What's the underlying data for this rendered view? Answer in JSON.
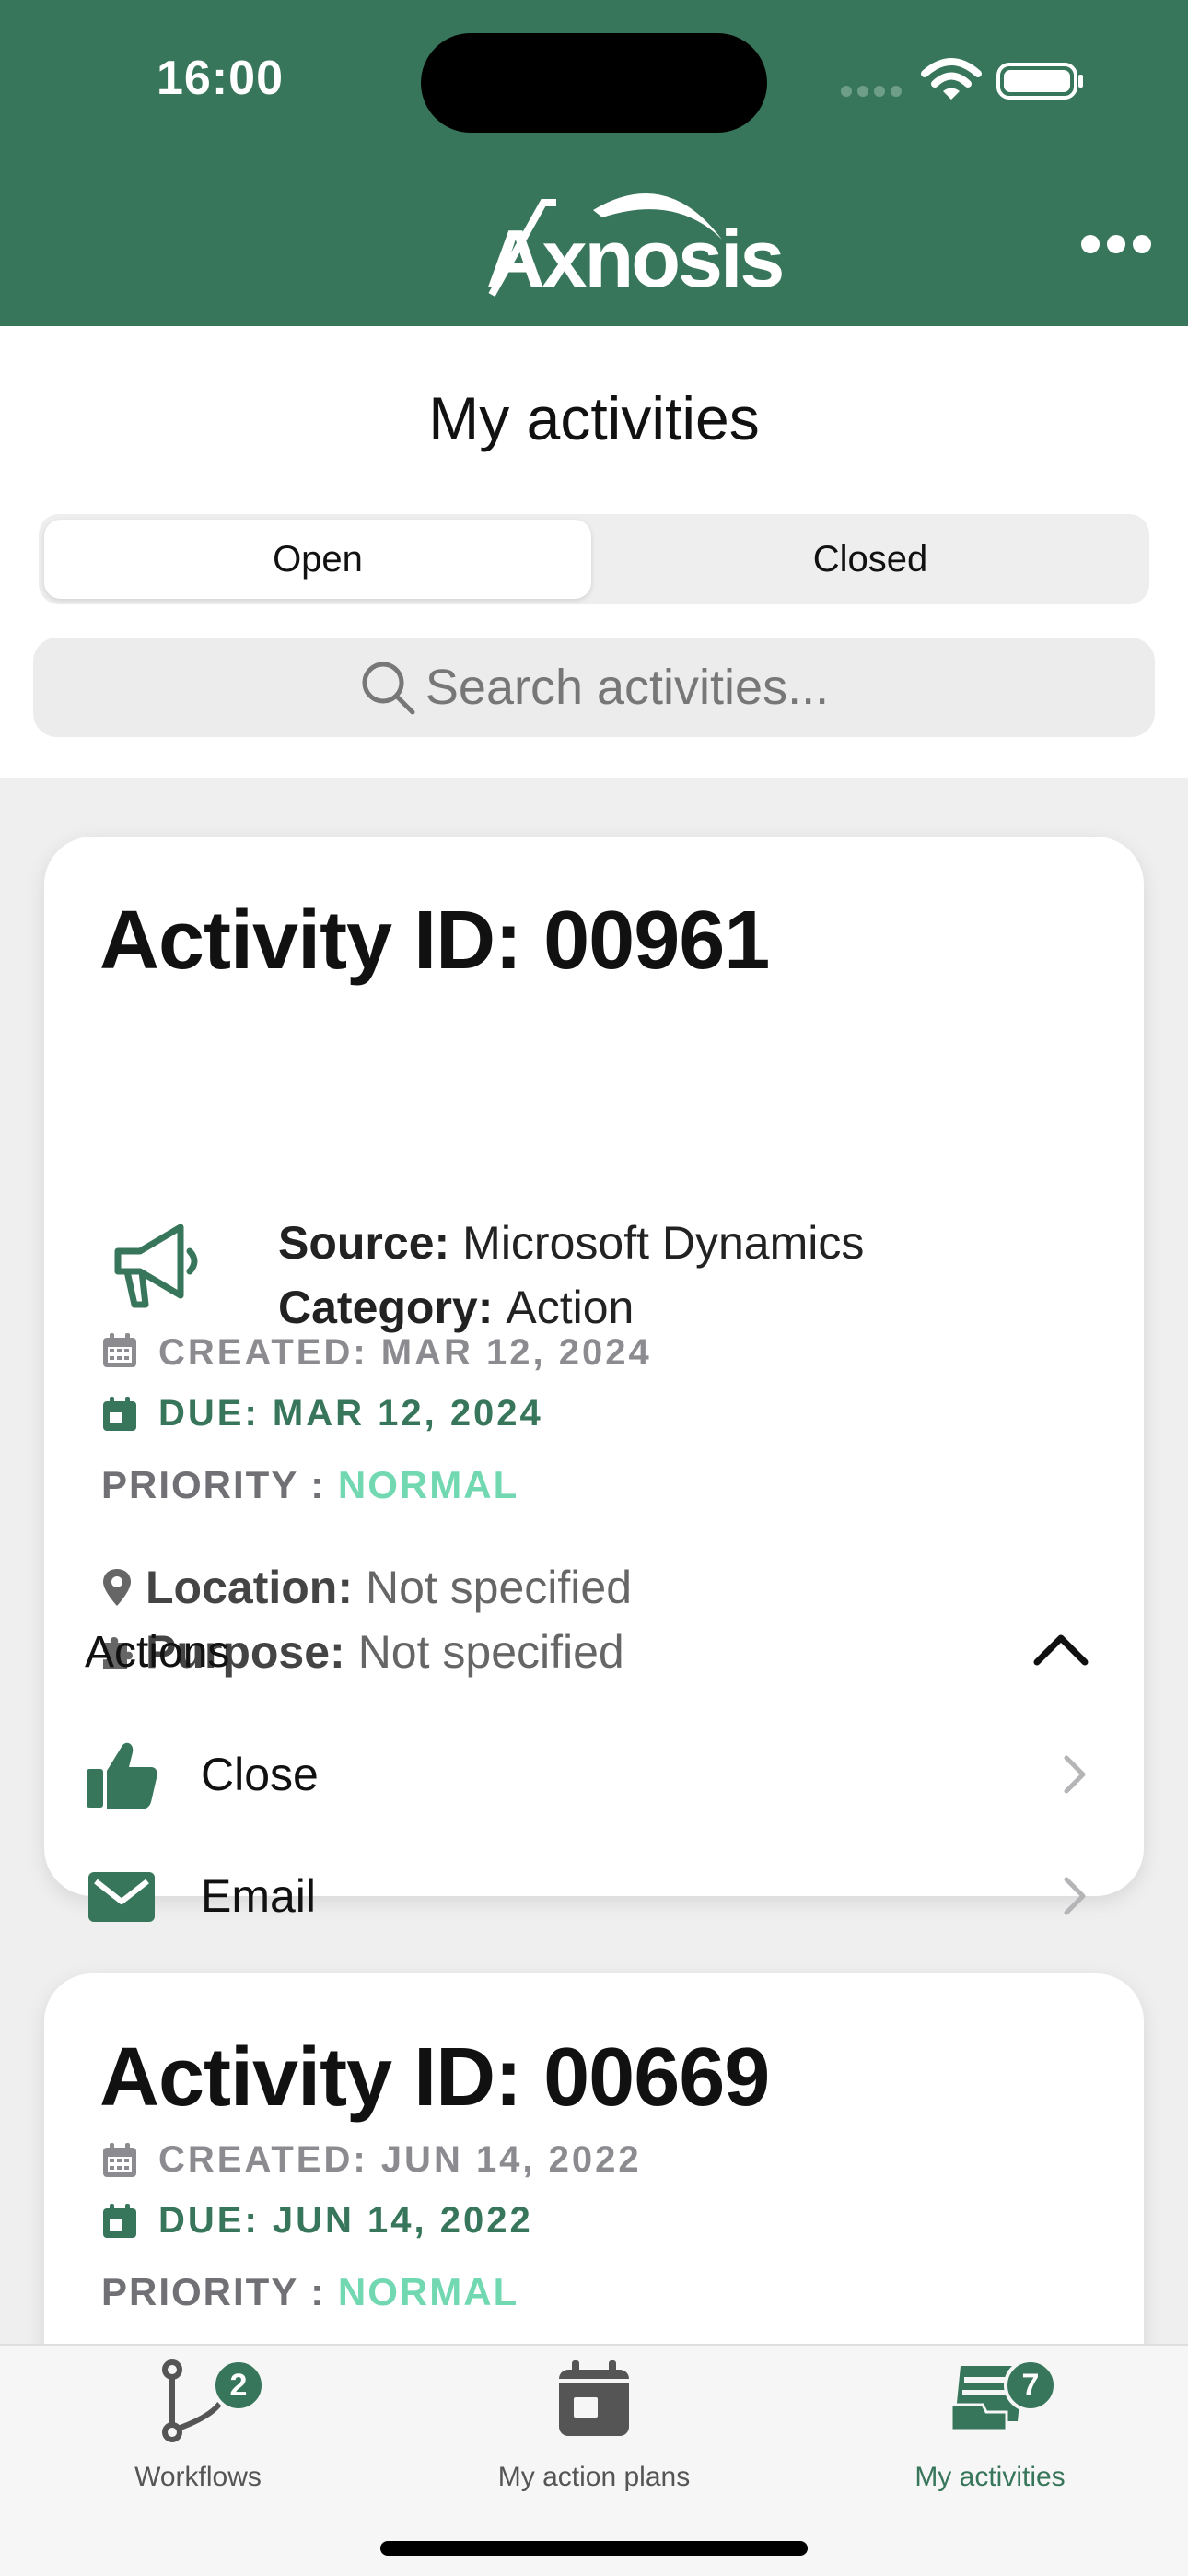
{
  "status_bar": {
    "time": "16:00"
  },
  "header": {
    "logo_text": "Axnosis",
    "more_icon": "ellipsis-icon"
  },
  "page": {
    "title": "My activities"
  },
  "segments": [
    {
      "label": "Open",
      "selected": true
    },
    {
      "label": "Closed",
      "selected": false
    }
  ],
  "search": {
    "placeholder": "Search activities..."
  },
  "activities": [
    {
      "id_label": "Activity ID: 00961",
      "created": "CREATED: MAR 12, 2024",
      "due": "DUE: MAR 12, 2024",
      "priority_label": "PRIORITY : ",
      "priority_value": "NORMAL",
      "location_label": "Location:",
      "location_value": "Not specified",
      "purpose_label": "Purpose:",
      "purpose_value": "Not specified",
      "source_label": "Source:",
      "source_value": "Microsoft Dynamics",
      "category_label": "Category:",
      "category_value": "Action",
      "actions_label": "Actions",
      "actions": [
        {
          "label": "Close",
          "icon": "thumbs-up-icon"
        },
        {
          "label": "Email",
          "icon": "envelope-icon"
        }
      ]
    },
    {
      "id_label": "Activity ID: 00669",
      "created": "CREATED: JUN 14, 2022",
      "due": "DUE: JUN 14, 2022",
      "priority_label": "PRIORITY : ",
      "priority_value": "NORMAL"
    }
  ],
  "tabbar": [
    {
      "label": "Workflows",
      "badge": "2",
      "icon": "workflow-branch-icon",
      "active": false
    },
    {
      "label": "My action plans",
      "badge": "",
      "icon": "calendar-icon",
      "active": false
    },
    {
      "label": "My activities",
      "badge": "7",
      "icon": "activities-stack-icon",
      "active": true
    }
  ],
  "colors": {
    "brand": "#37765b",
    "priority": "#72d8b2",
    "muted": "#8b8b90"
  }
}
